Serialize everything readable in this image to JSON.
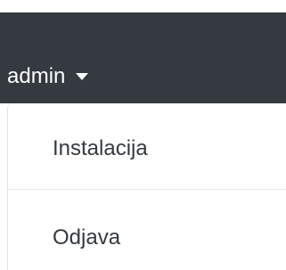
{
  "topbar": {
    "user_label": "admin",
    "dropdown_icon": "caret-down-icon"
  },
  "dropdown": {
    "items": [
      {
        "label": "Instalacija"
      },
      {
        "label": "Odjava"
      }
    ]
  },
  "colors": {
    "topbar_background": "#343a40",
    "topbar_text": "#ffffff",
    "menu_text": "#343a40",
    "divider": "#e6e8eb"
  }
}
